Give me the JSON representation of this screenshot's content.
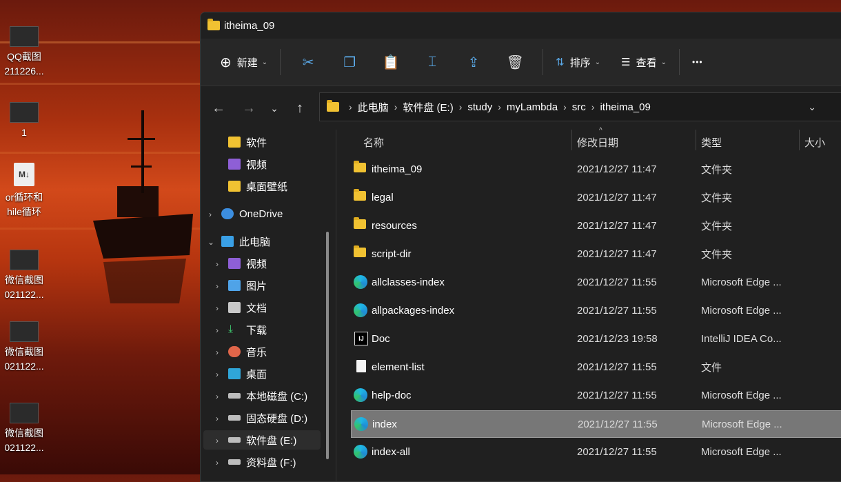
{
  "desktop": {
    "icons": [
      {
        "label1": "QQ截图",
        "label2": "211226..."
      },
      {
        "label1": "1",
        "label2": ""
      },
      {
        "label1": "or循环和",
        "label2": "hile循环"
      },
      {
        "label1": "微信截图",
        "label2": "021122..."
      },
      {
        "label1": "微信截图",
        "label2": "021122..."
      },
      {
        "label1": "微信截图",
        "label2": "021122..."
      }
    ]
  },
  "window": {
    "title": "itheima_09"
  },
  "toolbar": {
    "new_label": "新建",
    "sort_label": "排序",
    "view_label": "查看",
    "more_label": "•••"
  },
  "address": {
    "crumbs": [
      "此电脑",
      "软件盘 (E:)",
      "study",
      "myLambda",
      "src",
      "itheima_09"
    ]
  },
  "nav": {
    "items": [
      {
        "label": "软件"
      },
      {
        "label": "视频"
      },
      {
        "label": "桌面壁纸"
      },
      {
        "label": "OneDrive"
      },
      {
        "label": "此电脑"
      },
      {
        "label": "视频"
      },
      {
        "label": "图片"
      },
      {
        "label": "文档"
      },
      {
        "label": "下载"
      },
      {
        "label": "音乐"
      },
      {
        "label": "桌面"
      },
      {
        "label": "本地磁盘 (C:)"
      },
      {
        "label": "固态硬盘 (D:)"
      },
      {
        "label": "软件盘 (E:)"
      },
      {
        "label": "资料盘 (F:)"
      }
    ]
  },
  "columns": {
    "name": "名称",
    "date": "修改日期",
    "type": "类型",
    "size": "大小"
  },
  "files": [
    {
      "name": "itheima_09",
      "date": "2021/12/27 11:47",
      "type": "文件夹"
    },
    {
      "name": "legal",
      "date": "2021/12/27 11:47",
      "type": "文件夹"
    },
    {
      "name": "resources",
      "date": "2021/12/27 11:47",
      "type": "文件夹"
    },
    {
      "name": "script-dir",
      "date": "2021/12/27 11:47",
      "type": "文件夹"
    },
    {
      "name": "allclasses-index",
      "date": "2021/12/27 11:55",
      "type": "Microsoft Edge ..."
    },
    {
      "name": "allpackages-index",
      "date": "2021/12/27 11:55",
      "type": "Microsoft Edge ..."
    },
    {
      "name": "Doc",
      "date": "2021/12/23 19:58",
      "type": "IntelliJ IDEA Co..."
    },
    {
      "name": "element-list",
      "date": "2021/12/27 11:55",
      "type": "文件"
    },
    {
      "name": "help-doc",
      "date": "2021/12/27 11:55",
      "type": "Microsoft Edge ..."
    },
    {
      "name": "index",
      "date": "2021/12/27 11:55",
      "type": "Microsoft Edge ..."
    },
    {
      "name": "index-all",
      "date": "2021/12/27 11:55",
      "type": "Microsoft Edge ..."
    }
  ]
}
